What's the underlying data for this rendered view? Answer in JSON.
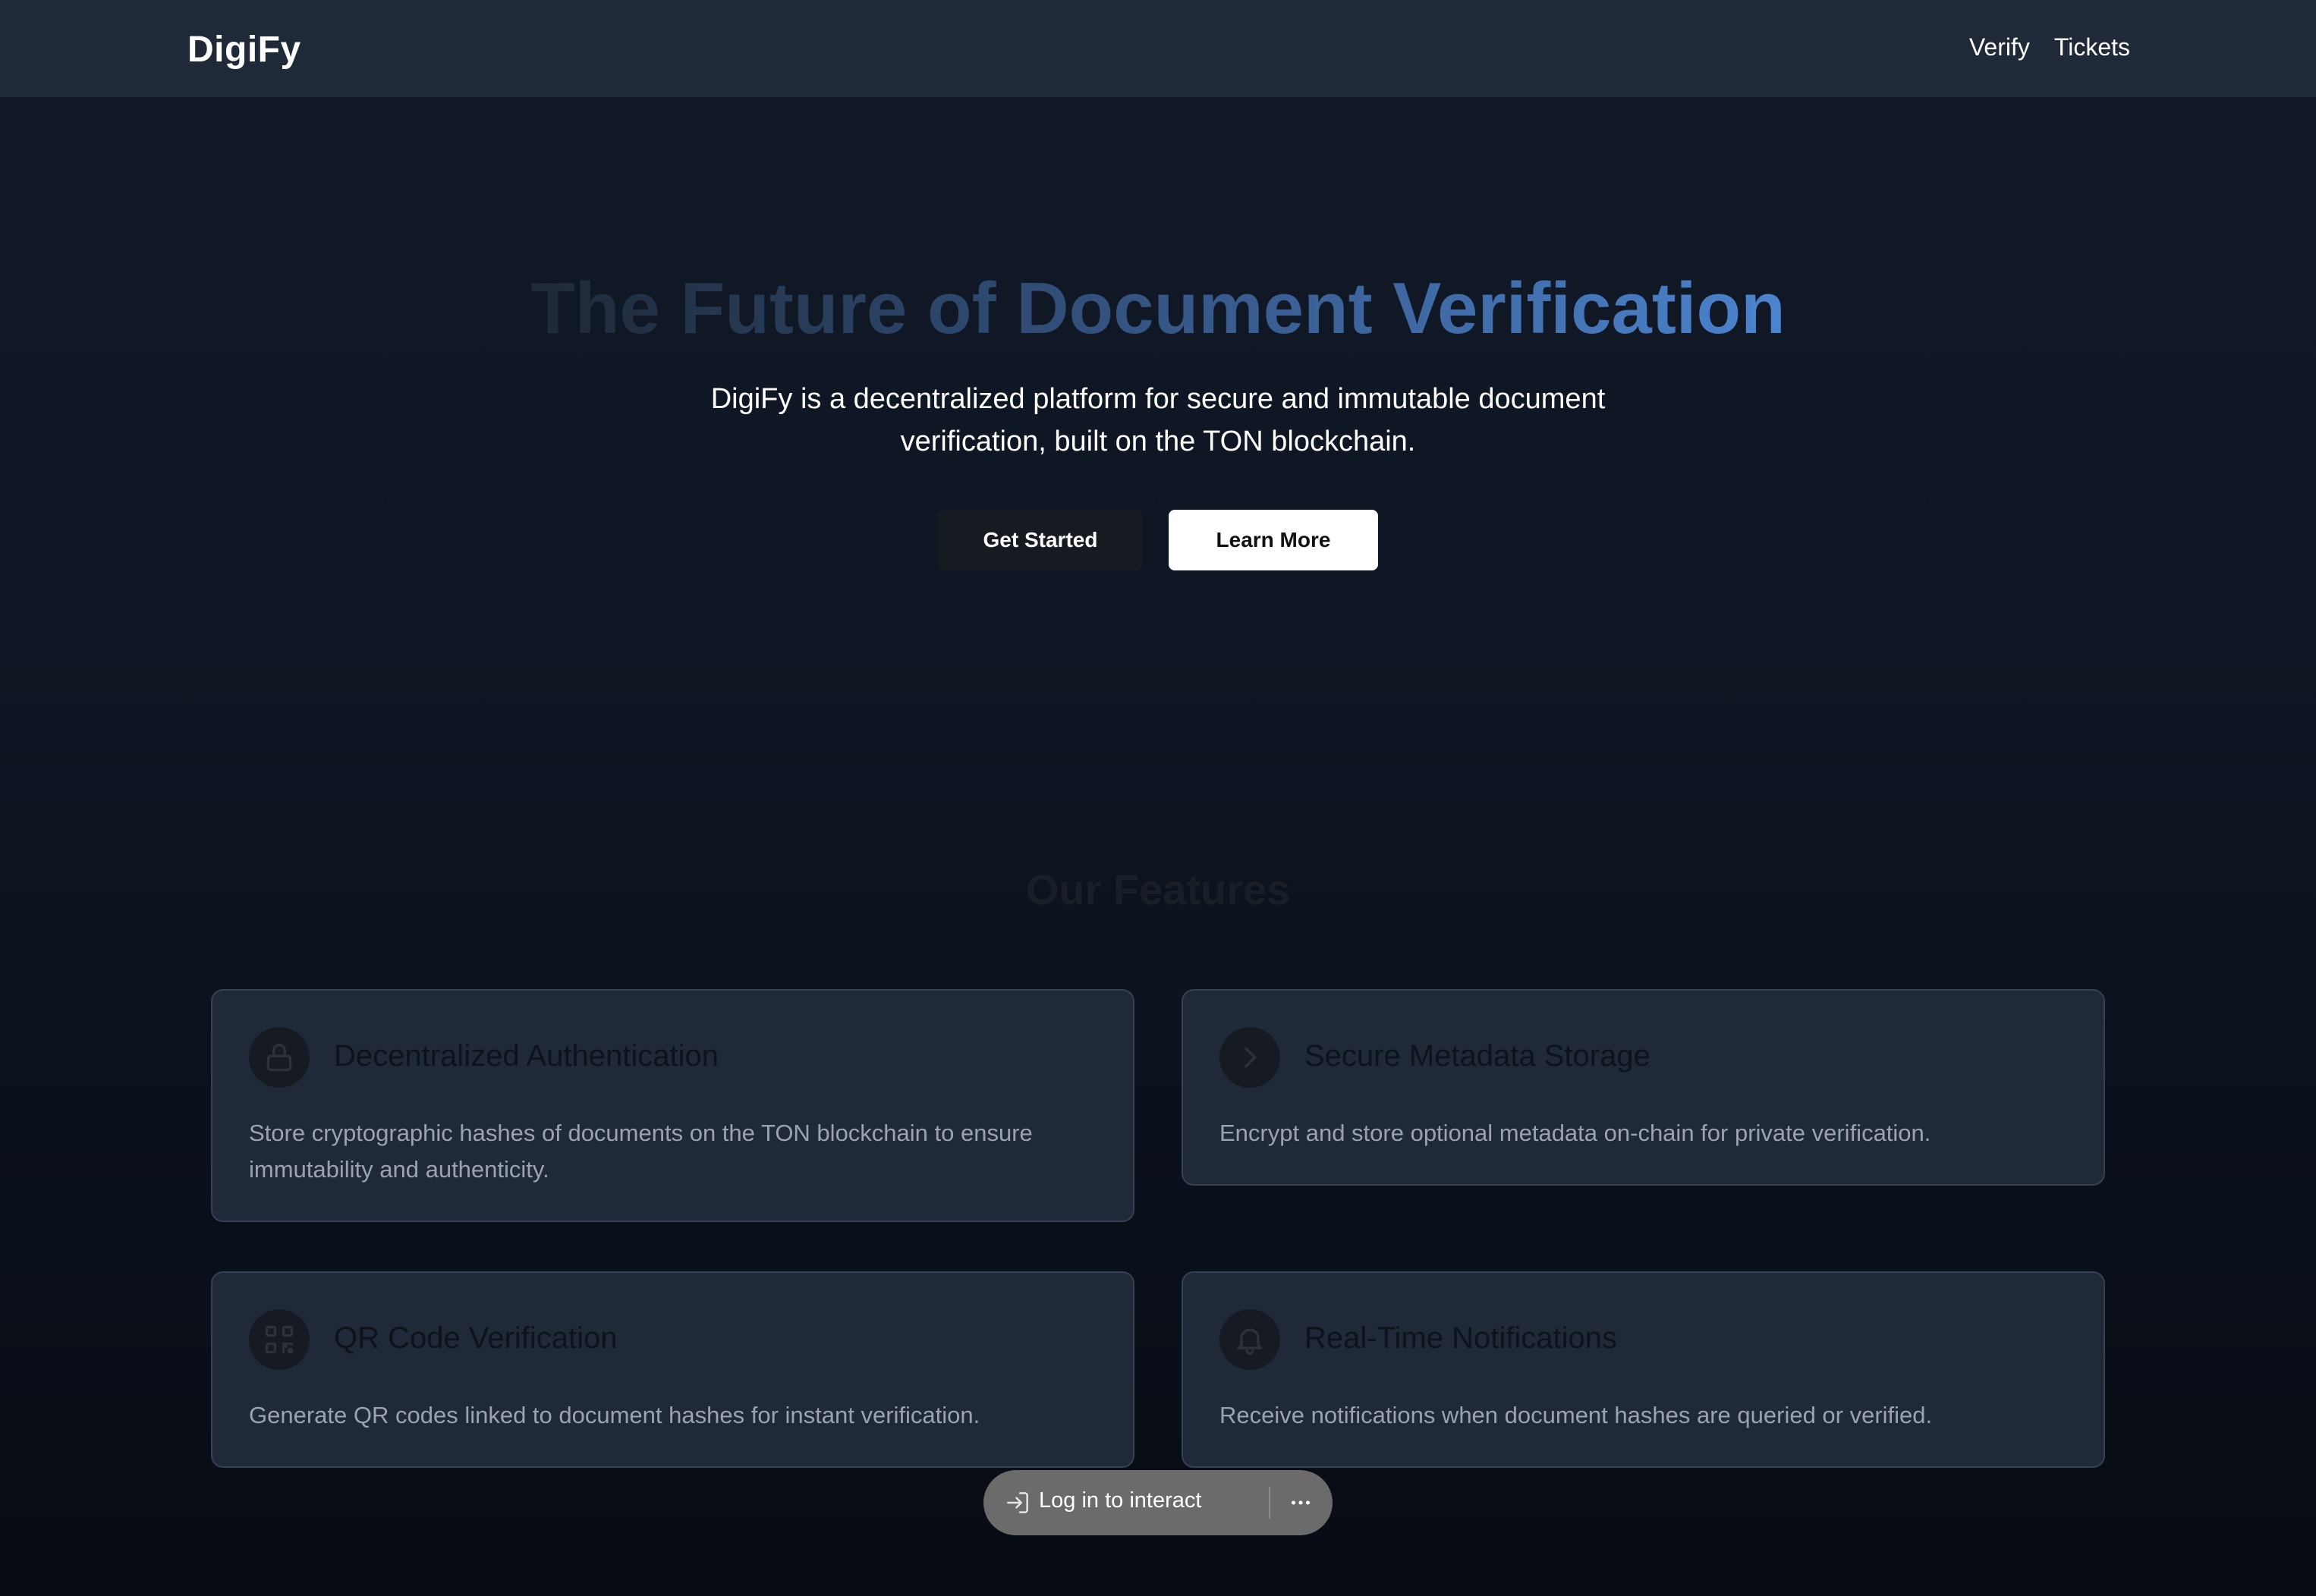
{
  "nav": {
    "brand": "DigiFy",
    "links": [
      "Verify",
      "Tickets"
    ]
  },
  "hero": {
    "title": "The Future of Document Verification",
    "subtitle_line1": "DigiFy is a decentralized platform for secure and immutable document",
    "subtitle_line2": "verification, built on the TON blockchain.",
    "primary_button": "Get Started",
    "secondary_button": "Learn More"
  },
  "features": {
    "heading": "Our Features",
    "items": [
      {
        "icon": "lock-icon",
        "title": "Decentralized Authentication",
        "description": "Store cryptographic hashes of documents on the TON blockchain to ensure immutability and authenticity."
      },
      {
        "icon": "chevron-right-icon",
        "title": "Secure Metadata Storage",
        "description": "Encrypt and store optional metadata on-chain for private verification."
      },
      {
        "icon": "qr-code-icon",
        "title": "QR Code Verification",
        "description": "Generate QR codes linked to document hashes for instant verification."
      },
      {
        "icon": "bell-icon",
        "title": "Real-Time Notifications",
        "description": "Receive notifications when document hashes are queried or verified."
      }
    ]
  },
  "login_bar": {
    "label": "Log in to interact",
    "icon": "login-icon",
    "more_icon": "more-icon"
  },
  "colors": {
    "navbar_bg": "#1f2937",
    "card_bg": "#1f2937",
    "card_border": "#374151",
    "title_gradient_end": "#4b84cf",
    "pill_bg": "#6b6b6b"
  }
}
